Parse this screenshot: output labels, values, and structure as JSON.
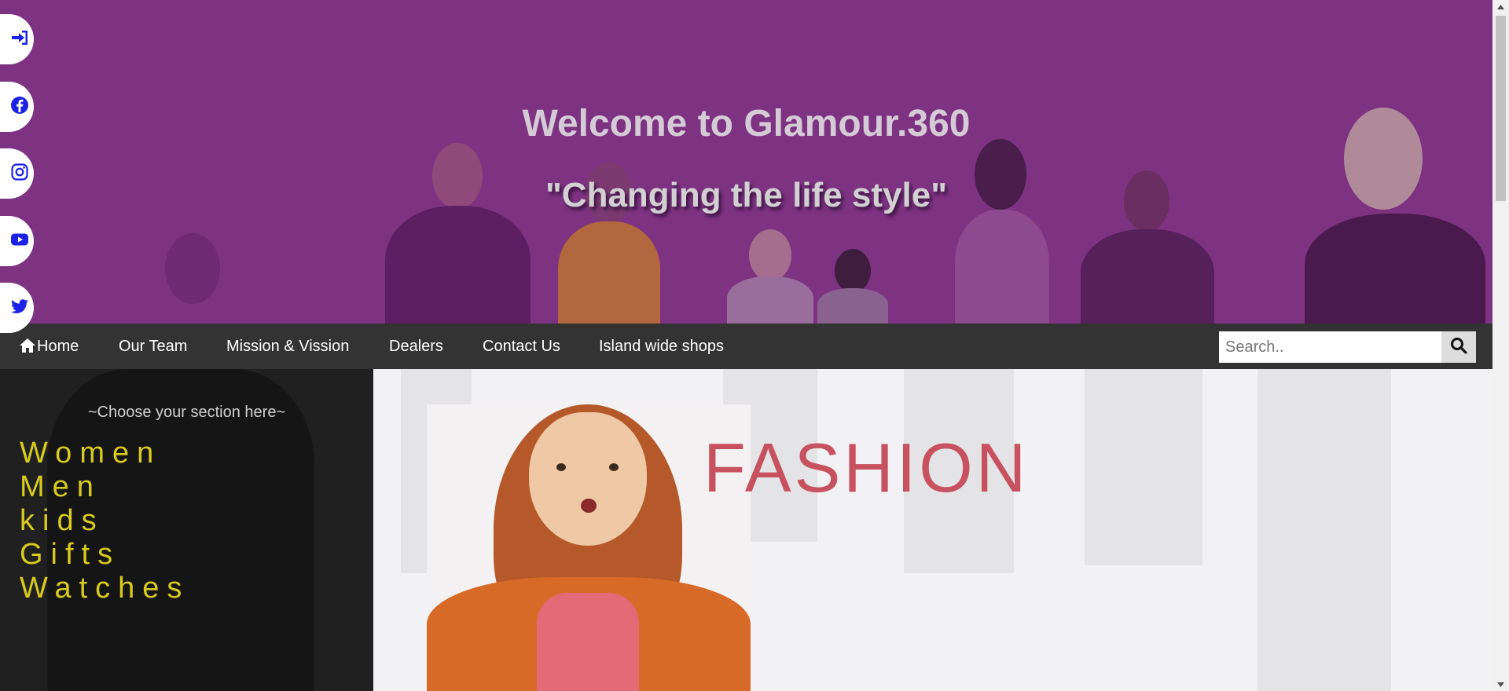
{
  "header": {
    "welcome": "Welcome to Glamour.360",
    "tagline": "\"Changing the life style\"",
    "background_color": "#7e3382"
  },
  "social": [
    {
      "name": "login-icon"
    },
    {
      "name": "facebook-icon"
    },
    {
      "name": "instagram-icon"
    },
    {
      "name": "youtube-icon"
    },
    {
      "name": "twitter-icon"
    }
  ],
  "social_icon_color": "#1b22e6",
  "nav": {
    "home": "Home",
    "team": "Our Team",
    "mission": "Mission & Vission",
    "dealers": "Dealers",
    "contact": "Contact Us",
    "shops": "Island wide shops"
  },
  "search": {
    "placeholder": "Search..",
    "value": ""
  },
  "sidebar": {
    "heading": "~Choose your section here~",
    "sections": [
      "Women",
      "Men",
      "kids",
      "Gifts",
      "Watches"
    ],
    "link_color": "#d8cb1c"
  },
  "hero": {
    "word": "FASHION",
    "word_color": "#c7515e"
  },
  "colors": {
    "navbar": "#333333",
    "sidebar": "#202020"
  }
}
